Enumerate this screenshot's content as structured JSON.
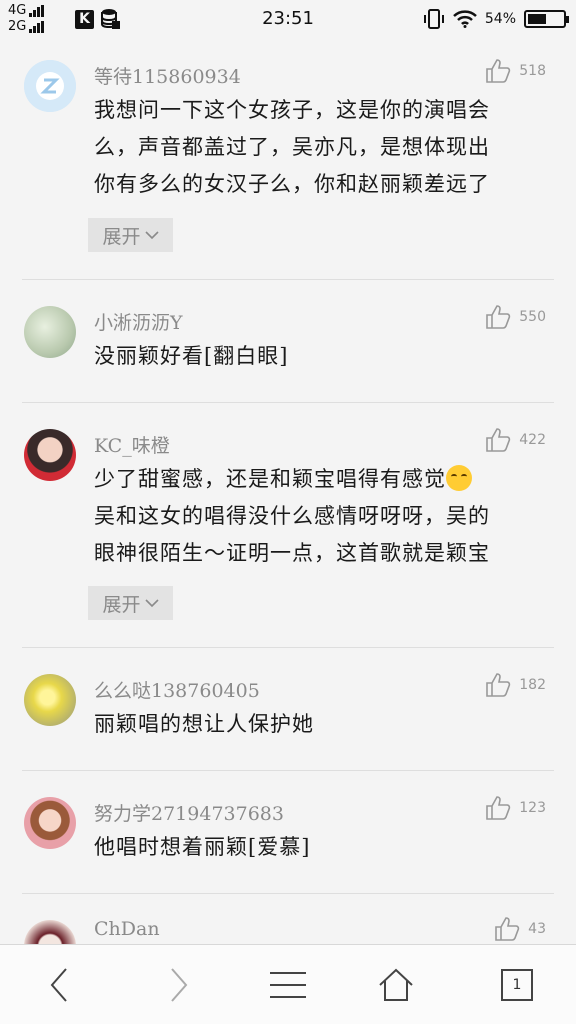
{
  "status_bar": {
    "net_4g": "4G",
    "net_2g": "2G",
    "time": "23:51",
    "battery": "54%",
    "battery_level": 0.54
  },
  "comments": [
    {
      "username": "等待115860934",
      "likes": "518",
      "lines": [
        "我想问一下这个女孩子，这是你的演唱会",
        "么，声音都盖过了，吴亦凡，是想体现出",
        "你有多么的女汉子么，你和赵丽颖差远了"
      ],
      "expand": "展开"
    },
    {
      "username": "小淅沥沥Y",
      "likes": "550",
      "lines": [
        "没丽颖好看[翻白眼]"
      ]
    },
    {
      "username": "KC_味橙",
      "likes": "422",
      "lines": [
        "少了甜蜜感，还是和颖宝唱得有感觉",
        "吴和这女的唱得没什么感情呀呀呀，吴的",
        "眼神很陌生～证明一点，这首歌就是颖宝"
      ],
      "expand": "展开"
    },
    {
      "username": "么么哒138760405",
      "likes": "182",
      "lines": [
        "丽颖唱的想让人保护她"
      ]
    },
    {
      "username": "努力学27194737683",
      "likes": "123",
      "lines": [
        "他唱时想着丽颖[爱慕]"
      ]
    },
    {
      "username": "ChDan",
      "likes": "43",
      "lines": []
    }
  ],
  "nav": {
    "tab_count": "1"
  }
}
